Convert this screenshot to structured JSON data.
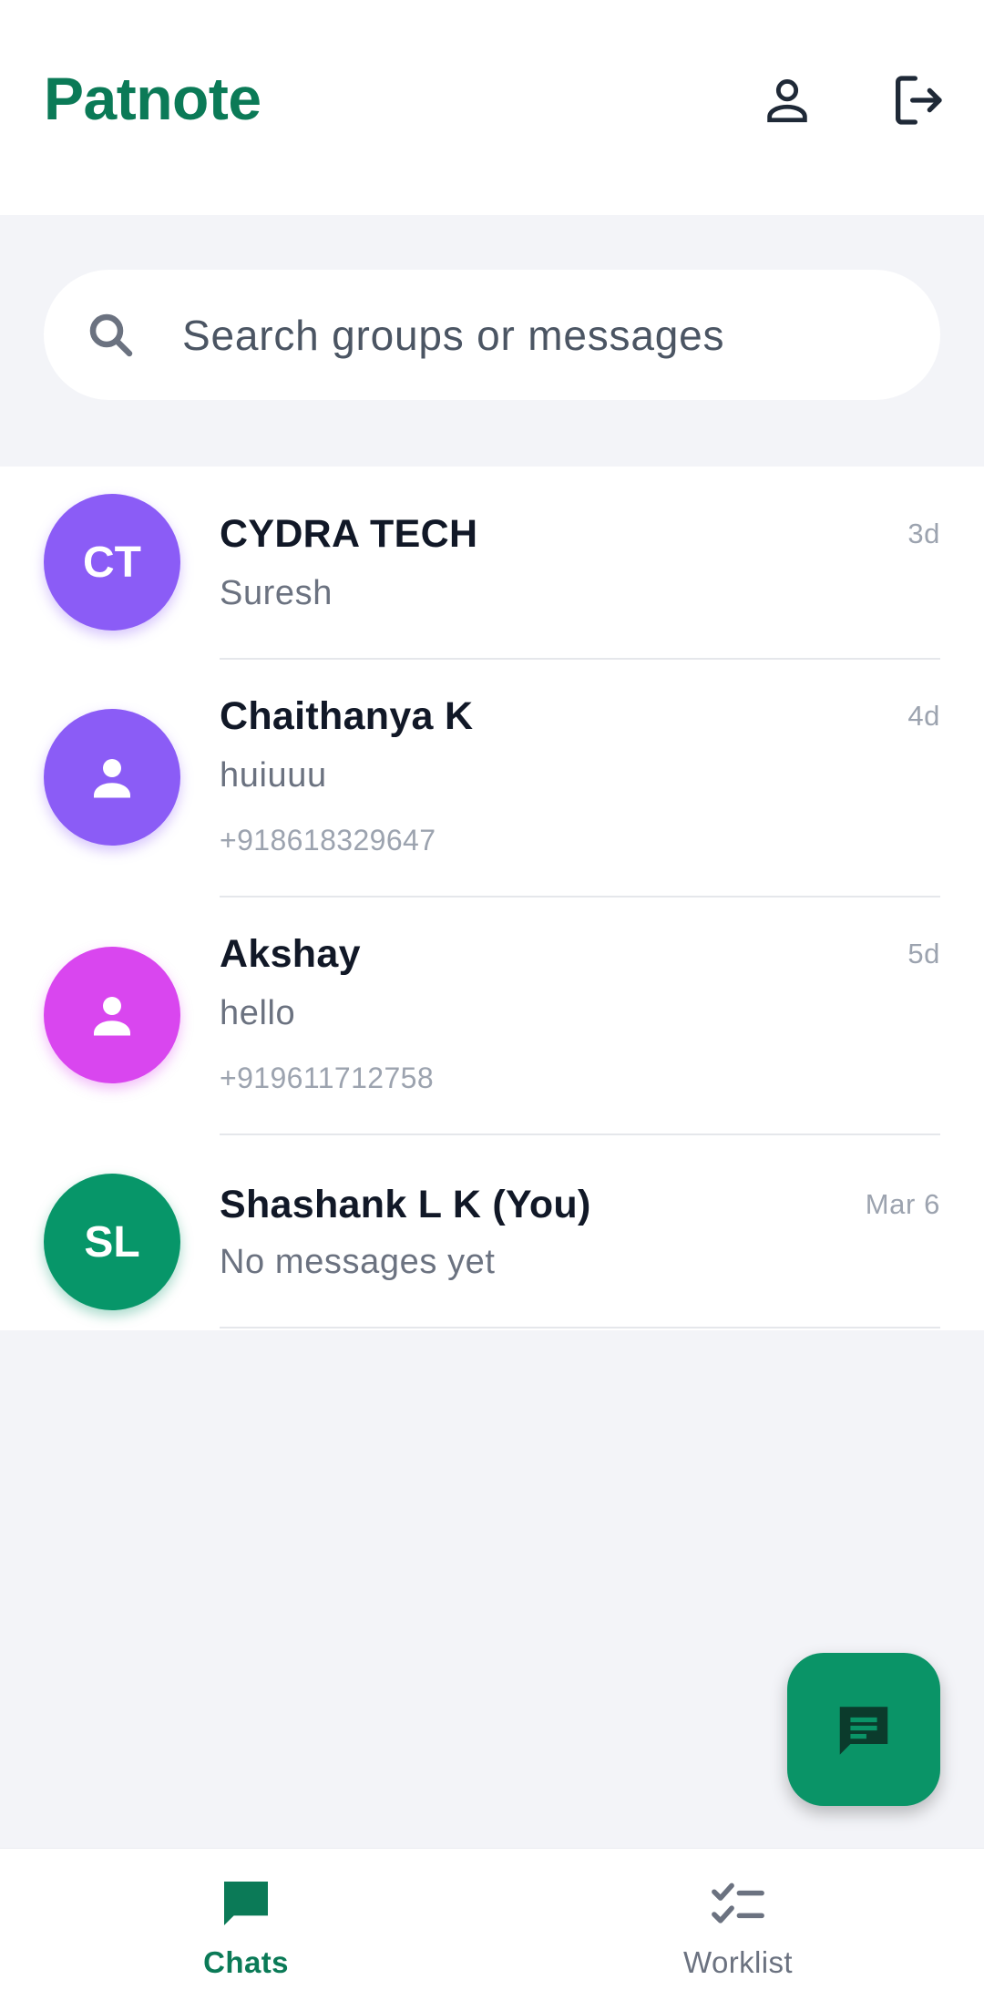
{
  "app": {
    "title": "Patnote",
    "brand_color": "#0b7a57"
  },
  "header": {
    "profile_icon": "person-outline-icon",
    "logout_icon": "logout-icon"
  },
  "search": {
    "placeholder": "Search groups or messages",
    "icon": "search-icon"
  },
  "chats": [
    {
      "initials": "CT",
      "name": "CYDRA TECH",
      "message": "Suresh",
      "phone": "",
      "time": "3d",
      "avatar_color": "#8b5cf6",
      "avatar_type": "initials"
    },
    {
      "initials": "",
      "name": "Chaithanya K",
      "message": "huiuuu",
      "phone": "+918618329647",
      "time": "4d",
      "avatar_color": "#8b5cf6",
      "avatar_type": "person-icon"
    },
    {
      "initials": "",
      "name": "Akshay",
      "message": "hello",
      "phone": "+919611712758",
      "time": "5d",
      "avatar_color": "#d946ef",
      "avatar_type": "person-icon"
    },
    {
      "initials": "SL",
      "name": "Shashank L K (You)",
      "message": "No messages yet",
      "phone": "",
      "time": "Mar 6",
      "avatar_color": "#079669",
      "avatar_type": "initials"
    }
  ],
  "fab": {
    "icon": "new-chat-icon",
    "color": "#0a9467"
  },
  "bottom_nav": {
    "items": [
      {
        "label": "Chats",
        "icon": "chat-bubble-icon",
        "active": true
      },
      {
        "label": "Worklist",
        "icon": "checklist-icon",
        "active": false
      }
    ]
  }
}
